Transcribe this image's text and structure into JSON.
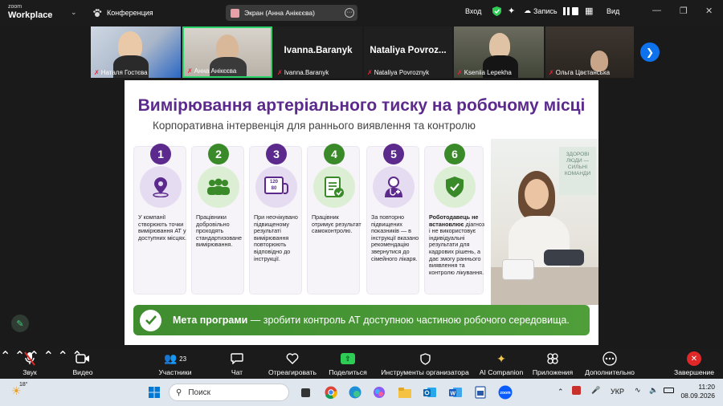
{
  "app": {
    "logo_line1": "zoom",
    "logo_line2": "Workplace",
    "conference_label": "Конференция",
    "screen_share_label": "Экран (Анна Анікєєва)",
    "signin_label": "Вход",
    "record_label": "Запись",
    "view_label": "Вид"
  },
  "participants": [
    {
      "name": "Наталя Гостєва",
      "type": "video"
    },
    {
      "name": "Анна Анікєєва",
      "type": "video",
      "active_speaker": true
    },
    {
      "name": "Ivanna.Baranyk",
      "display": "Ivanna.Baranyk",
      "type": "name"
    },
    {
      "name": "Nataliya Povroznyk",
      "display": "Nataliya  Povroz...",
      "type": "name"
    },
    {
      "name": "Kseniia Lepekha",
      "type": "video"
    },
    {
      "name": "Ольга Цвєтанська",
      "type": "video"
    }
  ],
  "slide": {
    "title": "Вимірювання артеріального тиску на робочому місці",
    "subtitle": "Корпоративна інтервенція для раннього виявлення та контролю",
    "steps": [
      {
        "num": "1",
        "color": "purple",
        "icon": "map-pin-icon",
        "text": "У компанії створюють точки вимірювання АТ у доступних місцях."
      },
      {
        "num": "2",
        "color": "green",
        "icon": "people-group-icon",
        "text": "Працівники добровільно проходять стандартизоване вимірювання."
      },
      {
        "num": "3",
        "color": "purple",
        "icon": "blood-pressure-monitor-icon",
        "text": "При неочікувано підвищеному результаті вимірювання повторюють відповідно до інструкції.",
        "monitor_top": "120",
        "monitor_bottom": "80"
      },
      {
        "num": "4",
        "color": "green",
        "icon": "clipboard-check-icon",
        "text": "Працівник отримує результат самоконтролю."
      },
      {
        "num": "5",
        "color": "purple",
        "icon": "doctor-icon",
        "text": "За повторно підвищених показників — в інструкції вказано рекомендацію звернутися до сімейного лікаря."
      },
      {
        "num": "6",
        "color": "green",
        "icon": "shield-check-icon",
        "text_bold": "Роботодавець не встановлює",
        "text": "діагноз і не використовує індивідуальні результати для кадрових рішень, а дає змогу раннього виявлення та контролю лікування."
      }
    ],
    "photo_poster": "ЗДОРОВІ ЛЮДИ — СИЛЬНІ КОМАНДИ",
    "goal_bold": "Мета програми",
    "goal_text": " — зробити контроль АТ доступною частиною робочого середовища."
  },
  "toolbar": {
    "audio": "Звук",
    "video": "Видео",
    "participants": "Участники",
    "participants_count": "23",
    "chat": "Чат",
    "react": "Отреагировать",
    "share": "Поделиться",
    "host_tools": "Инструменты организатора",
    "ai": "AI Companion",
    "apps": "Приложения",
    "more": "Дополнительно",
    "end": "Завершение"
  },
  "taskbar": {
    "weather_temp": "18°",
    "search_placeholder": "Поиск",
    "lang": "УКР",
    "time": "11:20",
    "date": "08.09.2026"
  },
  "colors": {
    "title_purple": "#5b2a8c",
    "step_green": "#3a8a2a",
    "zoom_blue": "#0e72ed",
    "share_green": "#2ecc55",
    "end_red": "#e02828"
  }
}
